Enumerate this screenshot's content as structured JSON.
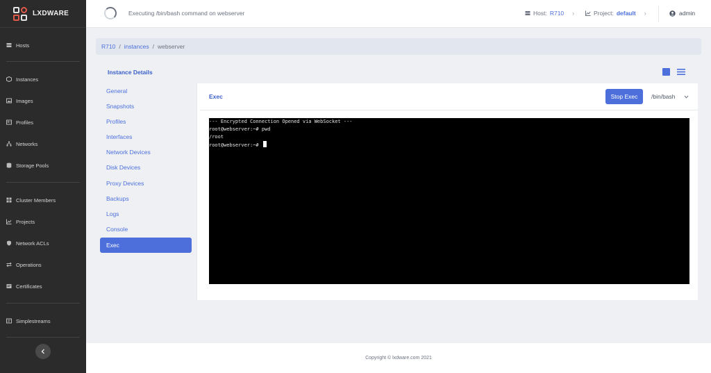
{
  "brand": {
    "name": "LXDWARE"
  },
  "sidebar": {
    "items": [
      {
        "label": "Hosts",
        "icon": "server-icon"
      },
      {
        "label": "Instances",
        "icon": "cube-icon"
      },
      {
        "label": "Images",
        "icon": "image-icon"
      },
      {
        "label": "Profiles",
        "icon": "profile-icon"
      },
      {
        "label": "Networks",
        "icon": "network-icon"
      },
      {
        "label": "Storage Pools",
        "icon": "database-icon"
      },
      {
        "label": "Cluster Members",
        "icon": "cluster-icon"
      },
      {
        "label": "Projects",
        "icon": "chart-icon"
      },
      {
        "label": "Network ACLs",
        "icon": "shield-icon"
      },
      {
        "label": "Operations",
        "icon": "exchange-icon"
      },
      {
        "label": "Certificates",
        "icon": "certificate-icon"
      },
      {
        "label": "Simplestreams",
        "icon": "stream-icon"
      }
    ]
  },
  "topbar": {
    "status": "Executing /bin/bash command on webserver",
    "host_label": "Host:",
    "host_value": "R710",
    "project_label": "Project:",
    "project_value": "default",
    "user": "admin"
  },
  "breadcrumb": {
    "items": [
      "R710",
      "instances",
      "webserver"
    ],
    "separator": "/"
  },
  "details": {
    "title": "Instance Details",
    "nav": [
      "General",
      "Snapshots",
      "Profiles",
      "Interfaces",
      "Network Devices",
      "Disk Devices",
      "Proxy Devices",
      "Backups",
      "Logs",
      "Console",
      "Exec"
    ],
    "active": "Exec"
  },
  "exec": {
    "title": "Exec",
    "stop_label": "Stop Exec",
    "shell_value": "/bin/bash",
    "terminal_lines": [
      "--- Encrypted Connection Opened via WebSocket ---",
      "root@webserver:~# pwd",
      "/root",
      "root@webserver:~# "
    ]
  },
  "footer": {
    "copyright": "Copyright © lxdware.com 2021"
  },
  "colors": {
    "accent": "#4c6fdc",
    "sidebar_bg": "#2b2b2b",
    "terminal_bg": "#000000"
  }
}
